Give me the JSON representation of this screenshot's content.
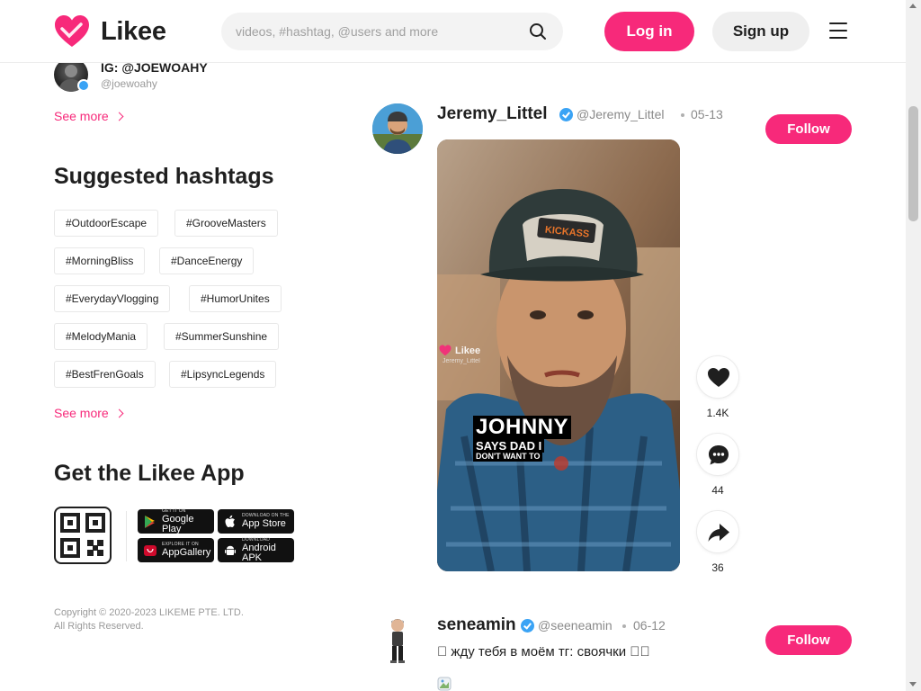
{
  "header": {
    "logo_text": "Likee",
    "search_placeholder": "videos, #hashtag, @users and more",
    "login_label": "Log in",
    "signup_label": "Sign up"
  },
  "sidebar": {
    "top_user": {
      "name": "IG: @JOEWOAHY",
      "handle": "@joewoahy"
    },
    "see_more_users": "See more",
    "hashtags_title": "Suggested hashtags",
    "hashtags": [
      "#OutdoorEscape",
      "#GrooveMasters",
      "#MorningBliss",
      "#DanceEnergy",
      "#EverydayVlogging",
      "#HumorUnites",
      "#MelodyMania",
      "#SummerSunshine",
      "#BestFrenGoals",
      "#LipsyncLegends"
    ],
    "see_more_hashtags": "See more",
    "app_title": "Get the Likee App",
    "stores": [
      {
        "small": "GET IT ON",
        "big": "Google Play"
      },
      {
        "small": "DOWNLOAD ON THE",
        "big": "App Store"
      },
      {
        "small": "EXPLORE IT ON",
        "big": "AppGallery"
      },
      {
        "small": "DOWNLOAD",
        "big": "Android APK"
      }
    ],
    "copyright_line1": "Copyright © 2020-2023 LIKEME PTE. LTD.",
    "copyright_line2": "All Rights Reserved."
  },
  "feed": {
    "posts": [
      {
        "name": "Jeremy_Littel",
        "handle": "@Jeremy_Littel",
        "date": "05-13",
        "follow_label": "Follow",
        "watermark_brand": "Likee",
        "watermark_user": "Jeremy_Littel",
        "caption_line1": "JOHNNY",
        "caption_line2": "SAYS DAD I",
        "caption_line3": "DON'T WANT TO",
        "likes": "1.4K",
        "comments": "44",
        "shares": "36"
      },
      {
        "name": "seneamin",
        "handle": "@seeneamin",
        "date": "06-12",
        "follow_label": "Follow",
        "text": "􀀀 жду тебя в моём тг: своячки 􀀀􀀀"
      }
    ]
  },
  "colors": {
    "brand_pink": "#f7297a",
    "verified_blue": "#3aa3f5"
  }
}
